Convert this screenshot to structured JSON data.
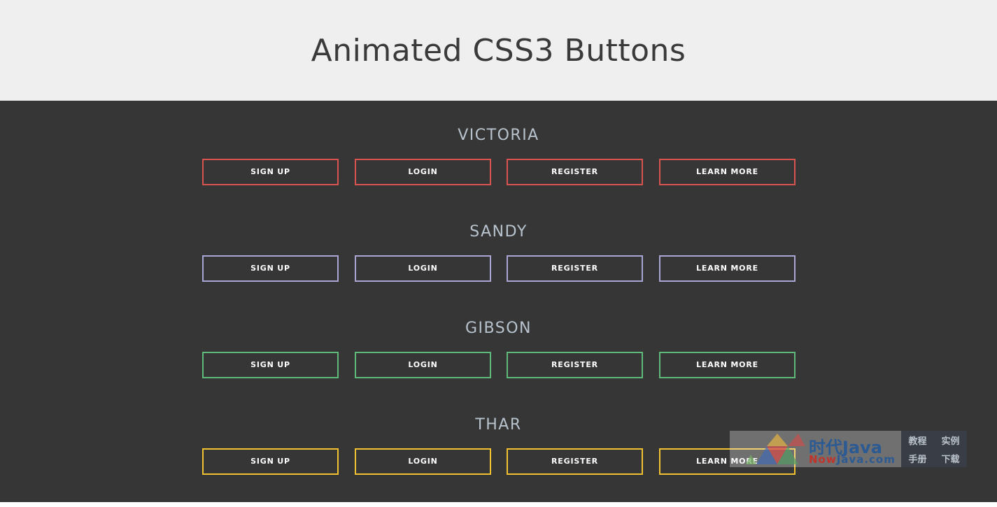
{
  "header": {
    "title": "Animated CSS3 Buttons"
  },
  "groups": [
    {
      "name": "VICTORIA",
      "border_color": "#d9534f",
      "buttons": [
        "SIGN UP",
        "LOGIN",
        "REGISTER",
        "LEARN MORE"
      ]
    },
    {
      "name": "SANDY",
      "border_color": "#a9a6d4",
      "buttons": [
        "SIGN UP",
        "LOGIN",
        "REGISTER",
        "LEARN MORE"
      ]
    },
    {
      "name": "GIBSON",
      "border_color": "#5fb97a",
      "buttons": [
        "SIGN UP",
        "LOGIN",
        "REGISTER",
        "LEARN MORE"
      ]
    },
    {
      "name": "THAR",
      "border_color": "#f0c231",
      "buttons": [
        "SIGN UP",
        "LOGIN",
        "REGISTER",
        "LEARN MORE"
      ]
    }
  ],
  "watermark": {
    "brand": "时代Java",
    "sub_now": "Now",
    "sub_rest": "Java.com",
    "links": [
      "教程",
      "实例",
      "手册",
      "下载"
    ]
  },
  "colors": {
    "header_bg": "#efefef",
    "main_bg": "#363636",
    "title_text": "#3a3a3a",
    "group_title_text": "#b8c3cd"
  }
}
